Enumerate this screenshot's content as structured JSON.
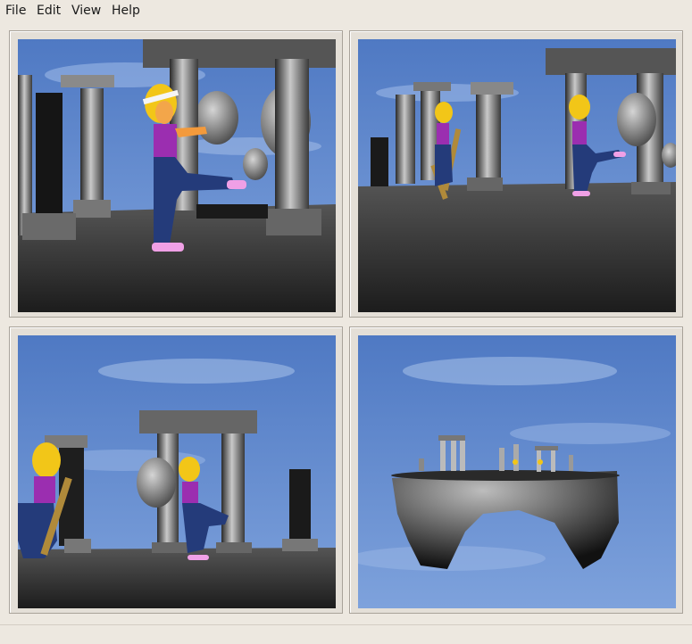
{
  "menubar": {
    "items": [
      {
        "label": "File"
      },
      {
        "label": "Edit"
      },
      {
        "label": "View"
      },
      {
        "label": "Help"
      }
    ]
  },
  "viewports": [
    {
      "name": "viewport-top-left"
    },
    {
      "name": "viewport-top-right"
    },
    {
      "name": "viewport-bottom-left"
    },
    {
      "name": "viewport-bottom-right"
    }
  ],
  "colors": {
    "window_bg": "#ede8e0",
    "sky": "#5c84c8",
    "ground": "#3a3a3a"
  }
}
